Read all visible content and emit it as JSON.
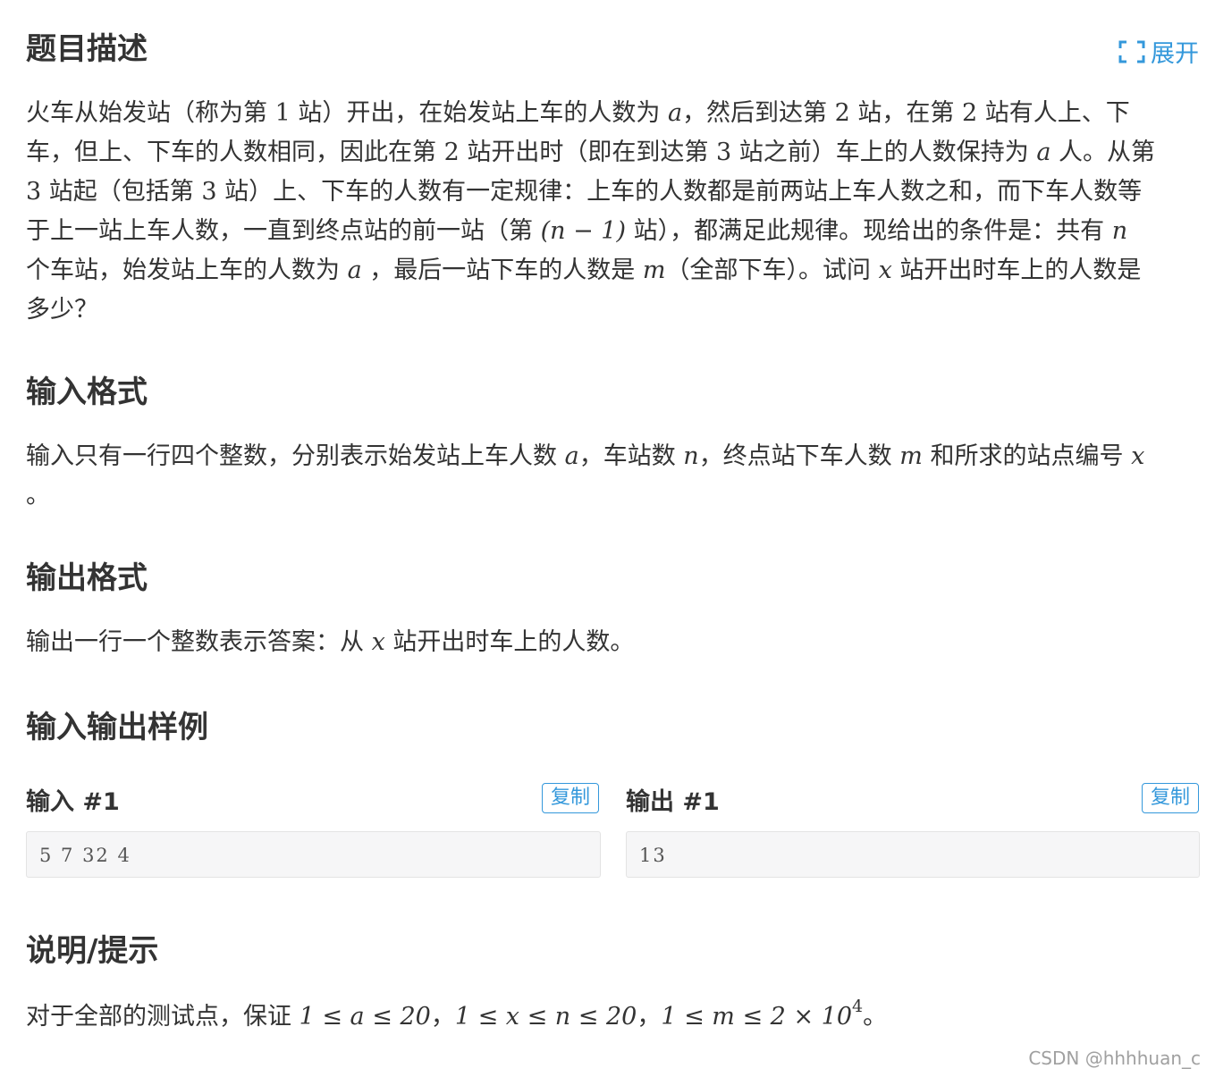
{
  "sections": {
    "description": {
      "title": "题目描述",
      "lines": [
        [
          "火车从始发站（称为第 ",
          "1",
          " 站）开出，在始发站上车的人数为 ",
          "a",
          "，然后到达第 ",
          "2",
          " 站，在第 ",
          "2",
          " 站有人上、下"
        ],
        [
          "车，但上、下车的人数相同，因此在第 ",
          "2",
          " 站开出时（即在到达第 ",
          "3",
          " 站之前）车上的人数保持为 ",
          "a",
          " 人。从第"
        ],
        [
          "3",
          " 站起（包括第 ",
          "3",
          " 站）上、下车的人数有一定规律：上车的人数都是前两站上车人数之和，而下车人数等"
        ],
        [
          "于上一站上车人数，一直到终点站的前一站（第 ",
          "(n − 1)",
          " 站），都满足此规律。现给出的条件是：共有 ",
          "n"
        ],
        [
          "个车站，始发站上车的人数为 ",
          "a",
          " ，最后一站下车的人数是 ",
          "m",
          "（全部下车）。试问 ",
          "x",
          " 站开出时车上的人数是"
        ],
        [
          "多少？"
        ]
      ]
    },
    "input_format": {
      "title": "输入格式",
      "lines": [
        [
          "输入只有一行四个整数，分别表示始发站上车人数 ",
          "a",
          "，车站数 ",
          "n",
          "，终点站下车人数 ",
          "m",
          " 和所求的站点编号 ",
          "x"
        ],
        [
          "。"
        ]
      ]
    },
    "output_format": {
      "title": "输出格式",
      "lines": [
        [
          "输出一行一个整数表示答案：从 ",
          "x",
          " 站开出时车上的人数。"
        ]
      ]
    },
    "samples": {
      "title": "输入输出样例",
      "input_label": "输入 #1",
      "output_label": "输出 #1",
      "copy_label": "复制",
      "input_value": "5 7 32 4",
      "output_value": "13"
    },
    "hint": {
      "title": "说明/提示",
      "line": [
        "对于全部的测试点，保证 ",
        "1 ≤ a ≤ 20",
        "，",
        "1 ≤ x ≤ n ≤ 20",
        "，",
        "1 ≤ m ≤ 2 × 10",
        "4",
        "。"
      ]
    }
  },
  "expand_label": "展开",
  "icons": {
    "expand": "expand-icon"
  },
  "colors": {
    "accent": "#3498db",
    "text": "#333333",
    "code_bg": "#f6f6f7"
  },
  "watermark": "CSDN @hhhhuan_c"
}
